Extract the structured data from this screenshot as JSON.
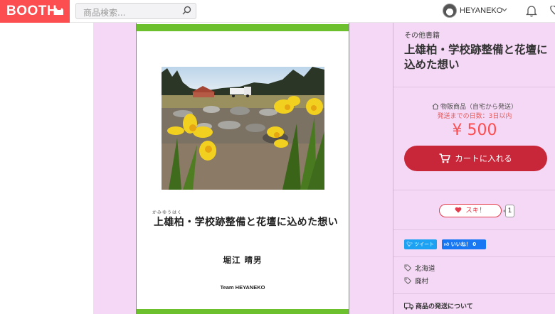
{
  "header": {
    "logo_text": "BOOTH",
    "search_placeholder": "商品検索...",
    "username": "HEYANEKO"
  },
  "cover": {
    "ruby": "かみゆうはく",
    "title": "上雄柏・学校跡整備と花壇に込めた想い",
    "author": "堀江 晴男",
    "publisher": "Team HEYANEKO"
  },
  "product": {
    "category": "その他書籍",
    "title": "上雄柏・学校跡整備と花壇に込めた想い",
    "shipping_type": "物販商品（自宅から発送）",
    "shipping_days": "発送までの日数：3日以内",
    "price": "¥ 500",
    "cart_label": "カートに入れる",
    "like_label": "スキ！",
    "like_count": "1",
    "tweet_label": "ツイート",
    "fb_label": "いいね！ 0",
    "tags": [
      "北海道",
      "廃村"
    ],
    "shipping_about": "商品の発送について"
  },
  "colors": {
    "brand": "#fc4d50",
    "cart_button": "#c8273a",
    "page_background": "#f5d8f5",
    "cover_band": "#6cbf2d"
  }
}
